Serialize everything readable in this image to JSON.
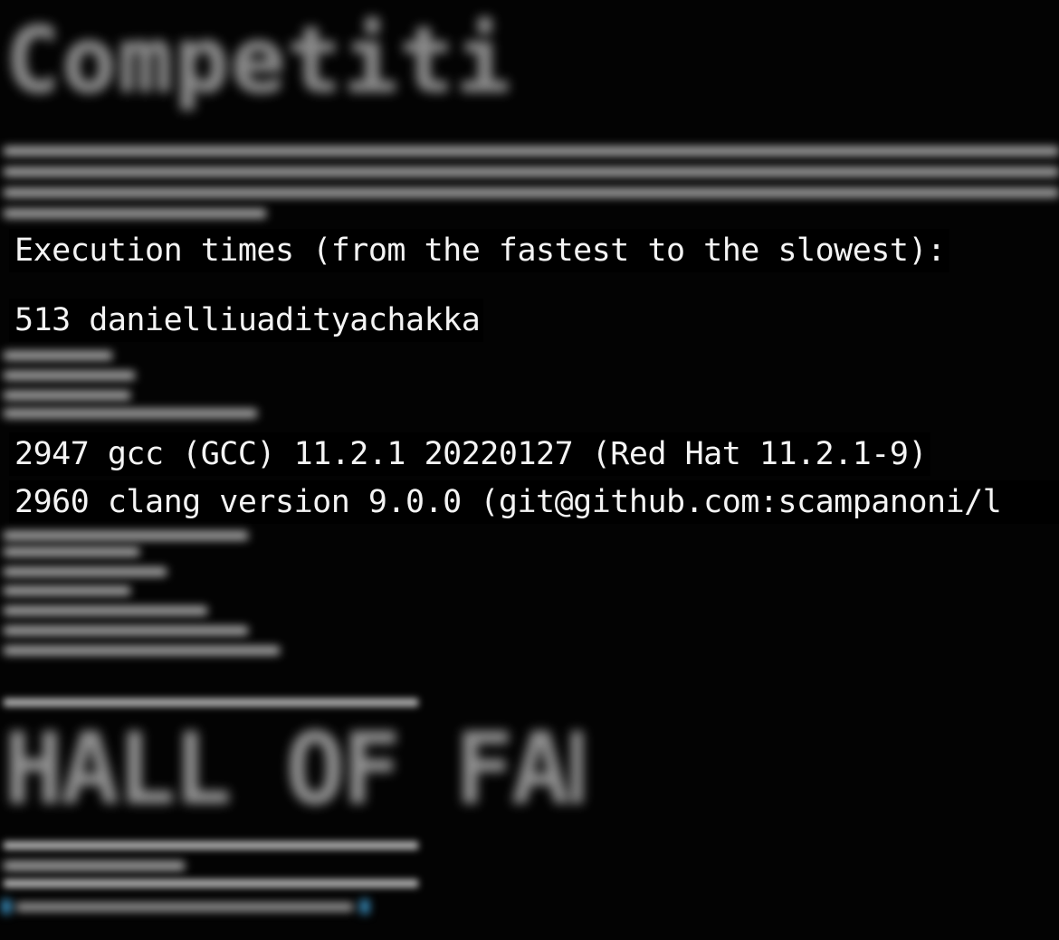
{
  "terminal": {
    "banner_top": "Competition",
    "banner_bottom": "HALL OF FAME",
    "header": "Execution times (from the fastest to the slowest):",
    "winner": "513 danielliuadityachakka",
    "gcc_line": "2947 gcc (GCC) 11.2.1 20220127 (Red Hat 11.2.1-9)",
    "clang_line": "2960 clang version 9.0.0 (git@github.com:scampanoni/l"
  },
  "colors": {
    "background": "#030303",
    "text": "#f4f4f4",
    "prompt_accent": "#3a8fbf"
  }
}
